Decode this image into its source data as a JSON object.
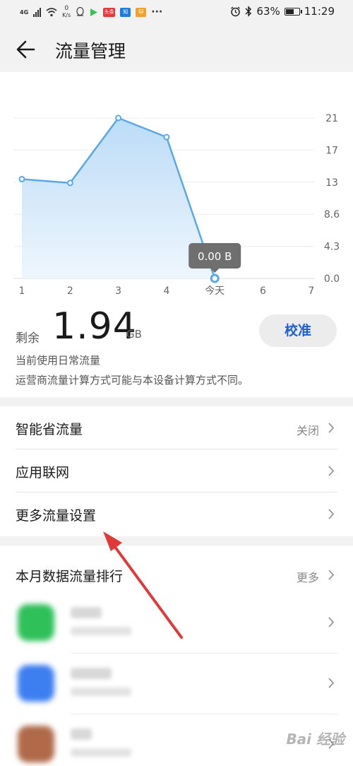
{
  "status_bar": {
    "network": "4G",
    "speed_value": "0",
    "speed_unit": "K/s",
    "more": "···",
    "battery": "63%",
    "battery_level": 0.63,
    "time": "11:29",
    "icons": [
      "signal-icon",
      "wifi-icon",
      "alarm-icon",
      "bluetooth-icon",
      "battery-icon"
    ]
  },
  "app_bar": {
    "title": "流量管理"
  },
  "chart_data": {
    "type": "area",
    "x": [
      "1",
      "2",
      "3",
      "4",
      "今天",
      "6",
      "7"
    ],
    "values": [
      13.0,
      12.5,
      21.0,
      18.5,
      0.0
    ],
    "y_ticks": [
      "21",
      "17",
      "13",
      "8.6",
      "4.3",
      "0.0"
    ],
    "ylim": [
      0,
      21
    ],
    "tooltip": "0.00 B",
    "highlight_index": 4,
    "colors": {
      "line": "#5aa7ea",
      "fill_top": "#bcdcf7",
      "fill_bottom": "#eef6fd",
      "tooltip_bg": "#6f6f6f"
    }
  },
  "summary": {
    "remaining_label": "剩余",
    "remaining_value": "1.94",
    "remaining_unit": "GB",
    "calibrate_label": "校准",
    "note1": "当前使用日常流量",
    "note2": "运营商流量计算方式可能与本设备计算方式不同。"
  },
  "settings": {
    "smart_saver": {
      "label": "智能省流量",
      "value": "关闭"
    },
    "app_network": {
      "label": "应用联网"
    },
    "more_settings": {
      "label": "更多流量设置"
    }
  },
  "ranking": {
    "title": "本月数据流量排行",
    "more_label": "更多"
  },
  "watermark": "Bai 经验",
  "colors": {
    "accent": "#1f5fd0",
    "arrow": "#e0393a",
    "background": "#f2f2f2"
  }
}
